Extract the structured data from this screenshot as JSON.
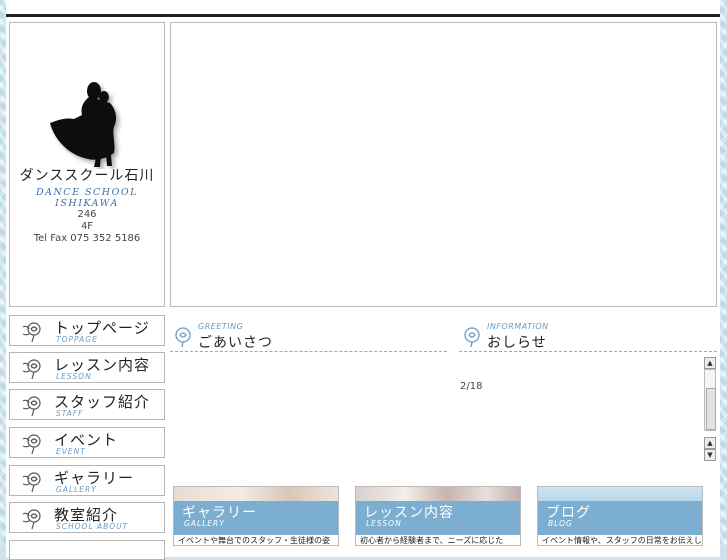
{
  "site": {
    "name_jp": "ダンススクール石川",
    "name_en": "DANCE SCHOOL ISHIKAWA",
    "address_line1": "246",
    "address_line2": "4F",
    "tel_fax": "Tel Fax 075 352 5186"
  },
  "nav": [
    {
      "jp": "トップページ",
      "en": "TOPPAGE"
    },
    {
      "jp": "レッスン内容",
      "en": "LESSON"
    },
    {
      "jp": "スタッフ紹介",
      "en": "STAFF"
    },
    {
      "jp": "イベント",
      "en": "EVENT"
    },
    {
      "jp": "ギャラリー",
      "en": "GALLERY"
    },
    {
      "jp": "教室紹介",
      "en": "SCHOOL ABOUT"
    }
  ],
  "greeting": {
    "en": "GREETING",
    "jp": "ごあいさつ"
  },
  "information": {
    "en": "INFORMATION",
    "jp": "おしらせ",
    "counter": "2/18"
  },
  "banners": [
    {
      "jp": "ギャラリー",
      "en": "GALLERY",
      "desc": "イベントや舞台でのスタッフ・生徒様の姿"
    },
    {
      "jp": "レッスン内容",
      "en": "LESSON",
      "desc": "初心者から経験者まで、ニーズに応じた"
    },
    {
      "jp": "ブログ",
      "en": "BLOG",
      "desc": "イベント情報や、スタッフの日常をお伝えし"
    }
  ],
  "colors": {
    "accent": "#7baed0",
    "accent_text": "#6a9cc7",
    "background": "#d6e8f2"
  }
}
